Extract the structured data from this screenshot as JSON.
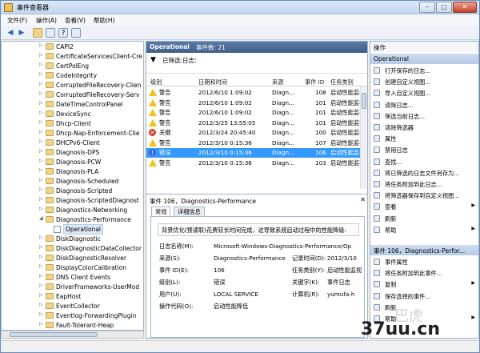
{
  "window": {
    "title": "事件查看器"
  },
  "menu": [
    "文件(F)",
    "操作(A)",
    "查看(V)",
    "帮助(H)"
  ],
  "tree": [
    {
      "label": "CAPI2"
    },
    {
      "label": "CertificateServicesClient-Cre"
    },
    {
      "label": "CertPolEng"
    },
    {
      "label": "CodeIntegrity"
    },
    {
      "label": "CorruptedFileRecovery-Clien"
    },
    {
      "label": "CorruptedFileRecovery-Serv"
    },
    {
      "label": "DateTimeControlPanel"
    },
    {
      "label": "DeviceSync"
    },
    {
      "label": "Dhcp-Client"
    },
    {
      "label": "Dhcp-Nap-Enforcement-Clie"
    },
    {
      "label": "DHCPv6-Client"
    },
    {
      "label": "Diagnosis-DPS"
    },
    {
      "label": "Diagnosis-PCW"
    },
    {
      "label": "Diagnosis-PLA"
    },
    {
      "label": "Diagnosis-Scheduled"
    },
    {
      "label": "Diagnosis-Scripted"
    },
    {
      "label": "Diagnosis-ScriptedDiagnost"
    },
    {
      "label": "Diagnostics-Networking"
    },
    {
      "label": "Diagnostics-Performance"
    },
    {
      "label": "Operational"
    },
    {
      "label": "DiskDiagnostic"
    },
    {
      "label": "DiskDiagnosticDataCollector"
    },
    {
      "label": "DiskDiagnosticResolver"
    },
    {
      "label": "DisplayColorCalibration"
    },
    {
      "label": "DNS Client Events"
    },
    {
      "label": "DriverFrameworks-UserMod"
    },
    {
      "label": "EapHost"
    },
    {
      "label": "EventCollector"
    },
    {
      "label": "Eventlog-ForwardingPlugin"
    },
    {
      "label": "Fault-Tolerant-Heap"
    }
  ],
  "mid": {
    "header_title": "Operational",
    "header_count": "事件数: 21",
    "filter_text": "已筛选:日志:",
    "columns": [
      "级别",
      "日期和时间",
      "来源",
      "事件 ID",
      "任务类别"
    ],
    "events": [
      {
        "level": "警告",
        "icon": "warning",
        "datetime": "2012/6/10 1:09:02",
        "source": "Diagn...",
        "id": "108",
        "task": "启动性能监视"
      },
      {
        "level": "警告",
        "icon": "warning",
        "datetime": "2012/6/10 1:09:02",
        "source": "Diagn...",
        "id": "101",
        "task": "启动性能监视"
      },
      {
        "level": "警告",
        "icon": "warning",
        "datetime": "2012/6/10 1:09:02",
        "source": "Diagn...",
        "id": "101",
        "task": "启动性能监视"
      },
      {
        "level": "警告",
        "icon": "warning",
        "datetime": "2012/3/25 13:55:05",
        "source": "Diagn...",
        "id": "101",
        "task": "启动性能监视"
      },
      {
        "level": "关键",
        "icon": "error",
        "datetime": "2012/3/24 20:45:40",
        "source": "Diagn...",
        "id": "100",
        "task": "启动性能监视"
      },
      {
        "level": "警告",
        "icon": "warning",
        "datetime": "2012/3/10 0:15:36",
        "source": "Diagn...",
        "id": "107",
        "task": "启动性能监视"
      },
      {
        "level": "错误",
        "icon": "info",
        "datetime": "2012/3/10 0:15:36",
        "source": "Diagn...",
        "id": "106",
        "task": "启动性能监视"
      },
      {
        "level": "警告",
        "icon": "warning",
        "datetime": "2012/3/10 0:15:36",
        "source": "Diagn...",
        "id": "103",
        "task": "启动性能监视"
      }
    ],
    "selected_index": 6
  },
  "detail": {
    "title": "事件 106，Diagnostics-Performance",
    "tabs": [
      "常规",
      "详细信息"
    ],
    "description": "背景优化(预读取)花费较长时间完成，这导致系统启动过程中的性能降级:",
    "fields": [
      {
        "k": "日志名称(M):",
        "v": "Microsoft-Windows-Diagnostics-Performance/Op"
      },
      {
        "k": "来源(S):",
        "v": "Diagnostics-Performance",
        "k2": "记录时间(D):",
        "v2": "2012/3/10"
      },
      {
        "k": "事件 ID(E):",
        "v": "106",
        "k2": "任务类别(Y):",
        "v2": "启动性能监视"
      },
      {
        "k": "级别(L):",
        "v": "错误",
        "k2": "关键字(K):",
        "v2": "事件日志"
      },
      {
        "k": "用户(U):",
        "v": "LOCAL SERVICE",
        "k2": "计算机(R):",
        "v2": "yumufa-h"
      },
      {
        "k": "操作代码(O):",
        "v": "启动性能降低"
      }
    ]
  },
  "actions": {
    "title": "操作",
    "section1": "Operational",
    "items1": [
      {
        "label": "打开保存的日志..."
      },
      {
        "label": "创建自定义视图..."
      },
      {
        "label": "导入自定义视图..."
      },
      {
        "label": "清除日志..."
      },
      {
        "label": "筛选当前日志..."
      },
      {
        "label": "清除筛选器"
      },
      {
        "label": "属性"
      },
      {
        "label": "禁用日志"
      },
      {
        "label": "查找..."
      },
      {
        "label": "将已筛选的日志文件另存为..."
      },
      {
        "label": "将任务附加到此日志..."
      },
      {
        "label": "将筛选器保存到自定义视图..."
      },
      {
        "label": "查看",
        "sub": "▶"
      },
      {
        "label": "刷新"
      },
      {
        "label": "帮助",
        "sub": "▶"
      }
    ],
    "section2": "事件 106，Diagnostics-Perfor...",
    "items2": [
      {
        "label": "事件属性"
      },
      {
        "label": "将任务附加到此事件..."
      },
      {
        "label": "复制",
        "sub": "▶"
      },
      {
        "label": "保存选择的事件..."
      },
      {
        "label": "刷新"
      },
      {
        "label": "帮助",
        "sub": "▶"
      }
    ]
  },
  "watermark": {
    "main": "37uu.cn"
  }
}
